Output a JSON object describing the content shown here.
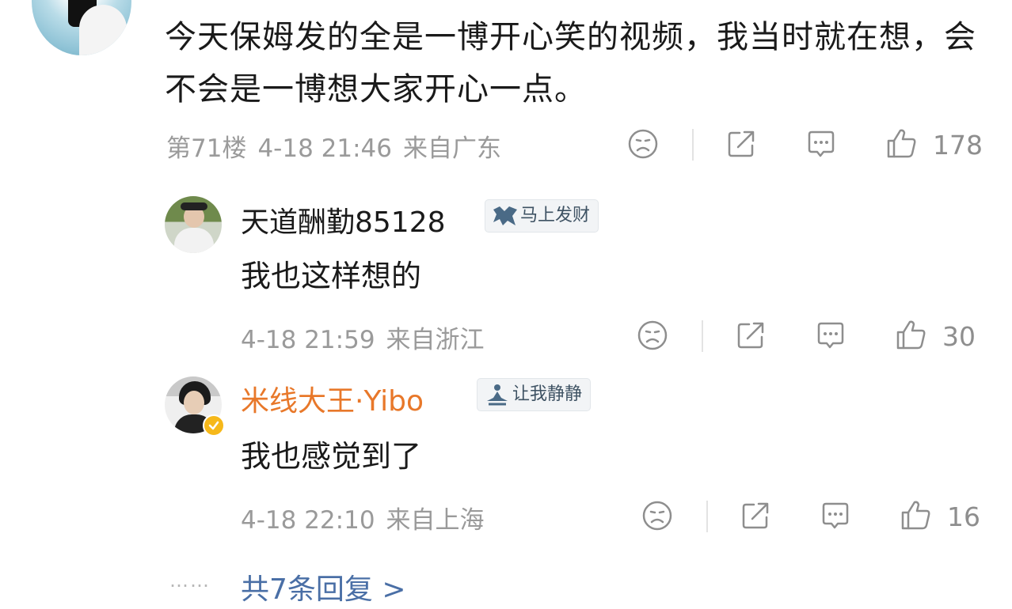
{
  "main_comment": {
    "text": "今天保姆发的全是一博开心笑的视频，我当时就在想，会不会是一博想大家开心一点。",
    "floor": "第71楼",
    "date": "4-18 21:46",
    "location": "来自广东",
    "likes": "178"
  },
  "replies": [
    {
      "username": "天道酬勤85128",
      "badge": "马上发财",
      "text": "我也这样想的",
      "date": "4-18 21:59",
      "location": "来自浙江",
      "likes": "30",
      "name_color": "#1a1a1a"
    },
    {
      "username": "米线大王·Yibo",
      "badge": "让我静静",
      "text": "我也感觉到了",
      "date": "4-18 22:10",
      "location": "来自上海",
      "likes": "16",
      "name_color": "#e8782a"
    }
  ],
  "footer": {
    "more_replies": "共7条回复 >",
    "dots": "……"
  },
  "icons": [
    "sad-face-icon",
    "share-icon",
    "comment-icon",
    "thumbs-up-icon",
    "verified-icon"
  ],
  "colors": {
    "link": "#4a6fa6",
    "meta": "#9a9a9a",
    "vip_name": "#e8782a"
  }
}
